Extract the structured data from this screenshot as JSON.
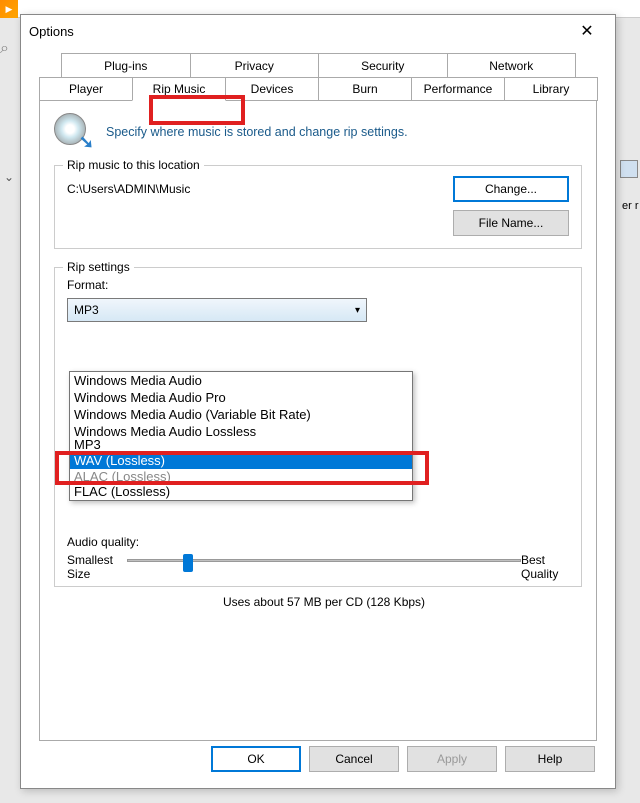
{
  "dialog": {
    "title": "Options",
    "close_glyph": "✕"
  },
  "tabs": {
    "row1": [
      "Plug-ins",
      "Privacy",
      "Security",
      "Network"
    ],
    "row2": [
      "Player",
      "Rip Music",
      "Devices",
      "Burn",
      "Performance",
      "Library"
    ],
    "selected": "Rip Music"
  },
  "header": {
    "text": "Specify where music is stored and change rip settings."
  },
  "location_group": {
    "legend": "Rip music to this location",
    "path": "C:\\Users\\ADMIN\\Music",
    "change_btn": "Change...",
    "filename_btn": "File Name..."
  },
  "rip_group": {
    "legend": "Rip settings",
    "format_label": "Format:",
    "selected_format": "MP3",
    "options": [
      "Windows Media Audio",
      "Windows Media Audio Pro",
      "Windows Media Audio (Variable Bit Rate)",
      "Windows Media Audio Lossless",
      "MP3",
      "WAV (Lossless)",
      "ALAC (Lossless)",
      "FLAC (Lossless)"
    ],
    "highlighted_option": "WAV (Lossless)"
  },
  "audio_quality": {
    "label": "Audio quality:",
    "left_label_1": "Smallest",
    "left_label_2": "Size",
    "right_label_1": "Best",
    "right_label_2": "Quality",
    "caption": "Uses about 57 MB per CD (128 Kbps)"
  },
  "buttons": {
    "ok": "OK",
    "cancel": "Cancel",
    "apply": "Apply",
    "help": "Help"
  },
  "background": {
    "er_text": "er r"
  }
}
